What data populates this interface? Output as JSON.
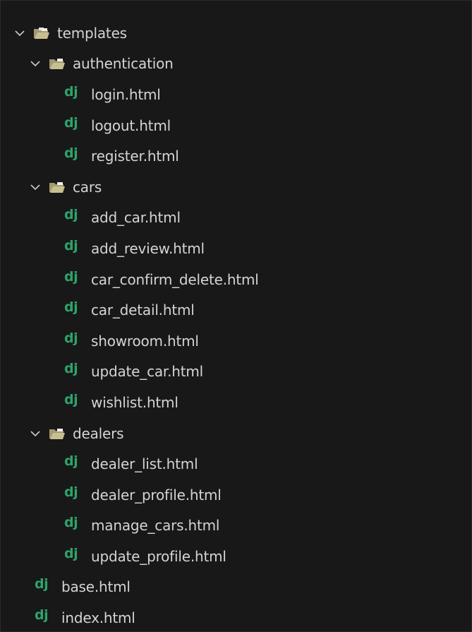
{
  "explorer": {
    "root": {
      "name": "templates",
      "expanded": true,
      "folders": [
        {
          "name": "authentication",
          "expanded": true,
          "files": [
            "login.html",
            "logout.html",
            "register.html"
          ]
        },
        {
          "name": "cars",
          "expanded": true,
          "files": [
            "add_car.html",
            "add_review.html",
            "car_confirm_delete.html",
            "car_detail.html",
            "showroom.html",
            "update_car.html",
            "wishlist.html"
          ]
        },
        {
          "name": "dealers",
          "expanded": true,
          "files": [
            "dealer_list.html",
            "dealer_profile.html",
            "manage_cars.html",
            "update_profile.html"
          ]
        }
      ],
      "files": [
        "base.html",
        "index.html"
      ]
    },
    "file_icon_text": "dj",
    "colors": {
      "background": "#181818",
      "label": "#d4d4d4",
      "chevron": "#cccccc",
      "dj_icon": "#2ea36a",
      "folder_icon": "#c8bf90"
    }
  }
}
